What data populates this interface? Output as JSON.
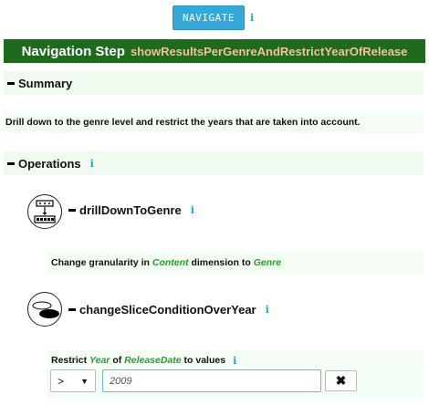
{
  "header": {
    "navigate_label": "NAVIGATE",
    "info_glyph": "i"
  },
  "title": {
    "prefix": "Navigation Step",
    "step_name": "showResultsPerGenreAndRestrictYearOfRelease"
  },
  "summary": {
    "label": "Summary",
    "text": "Drill down to the genre level and restrict the years that are taken into account."
  },
  "operations": {
    "label": "Operations",
    "items": [
      {
        "name": "drillDownToGenre",
        "desc_pre": "Change granularity in ",
        "desc_dim": "Content",
        "desc_mid": " dimension to ",
        "desc_level": "Genre"
      },
      {
        "name": "changeSliceConditionOverYear",
        "restrict_pre": "Restrict ",
        "restrict_level": "Year",
        "restrict_of": " of ",
        "restrict_dim": "ReleaseDate",
        "restrict_post": " to values",
        "operator": ">",
        "value_placeholder": "2009",
        "remove_glyph": "✖"
      }
    ]
  },
  "colors": {
    "accent": "#35a8d8",
    "title_bg": "#1e6b1e",
    "section_bg": "#eefbee",
    "italic_green": "#2a9b2a"
  }
}
